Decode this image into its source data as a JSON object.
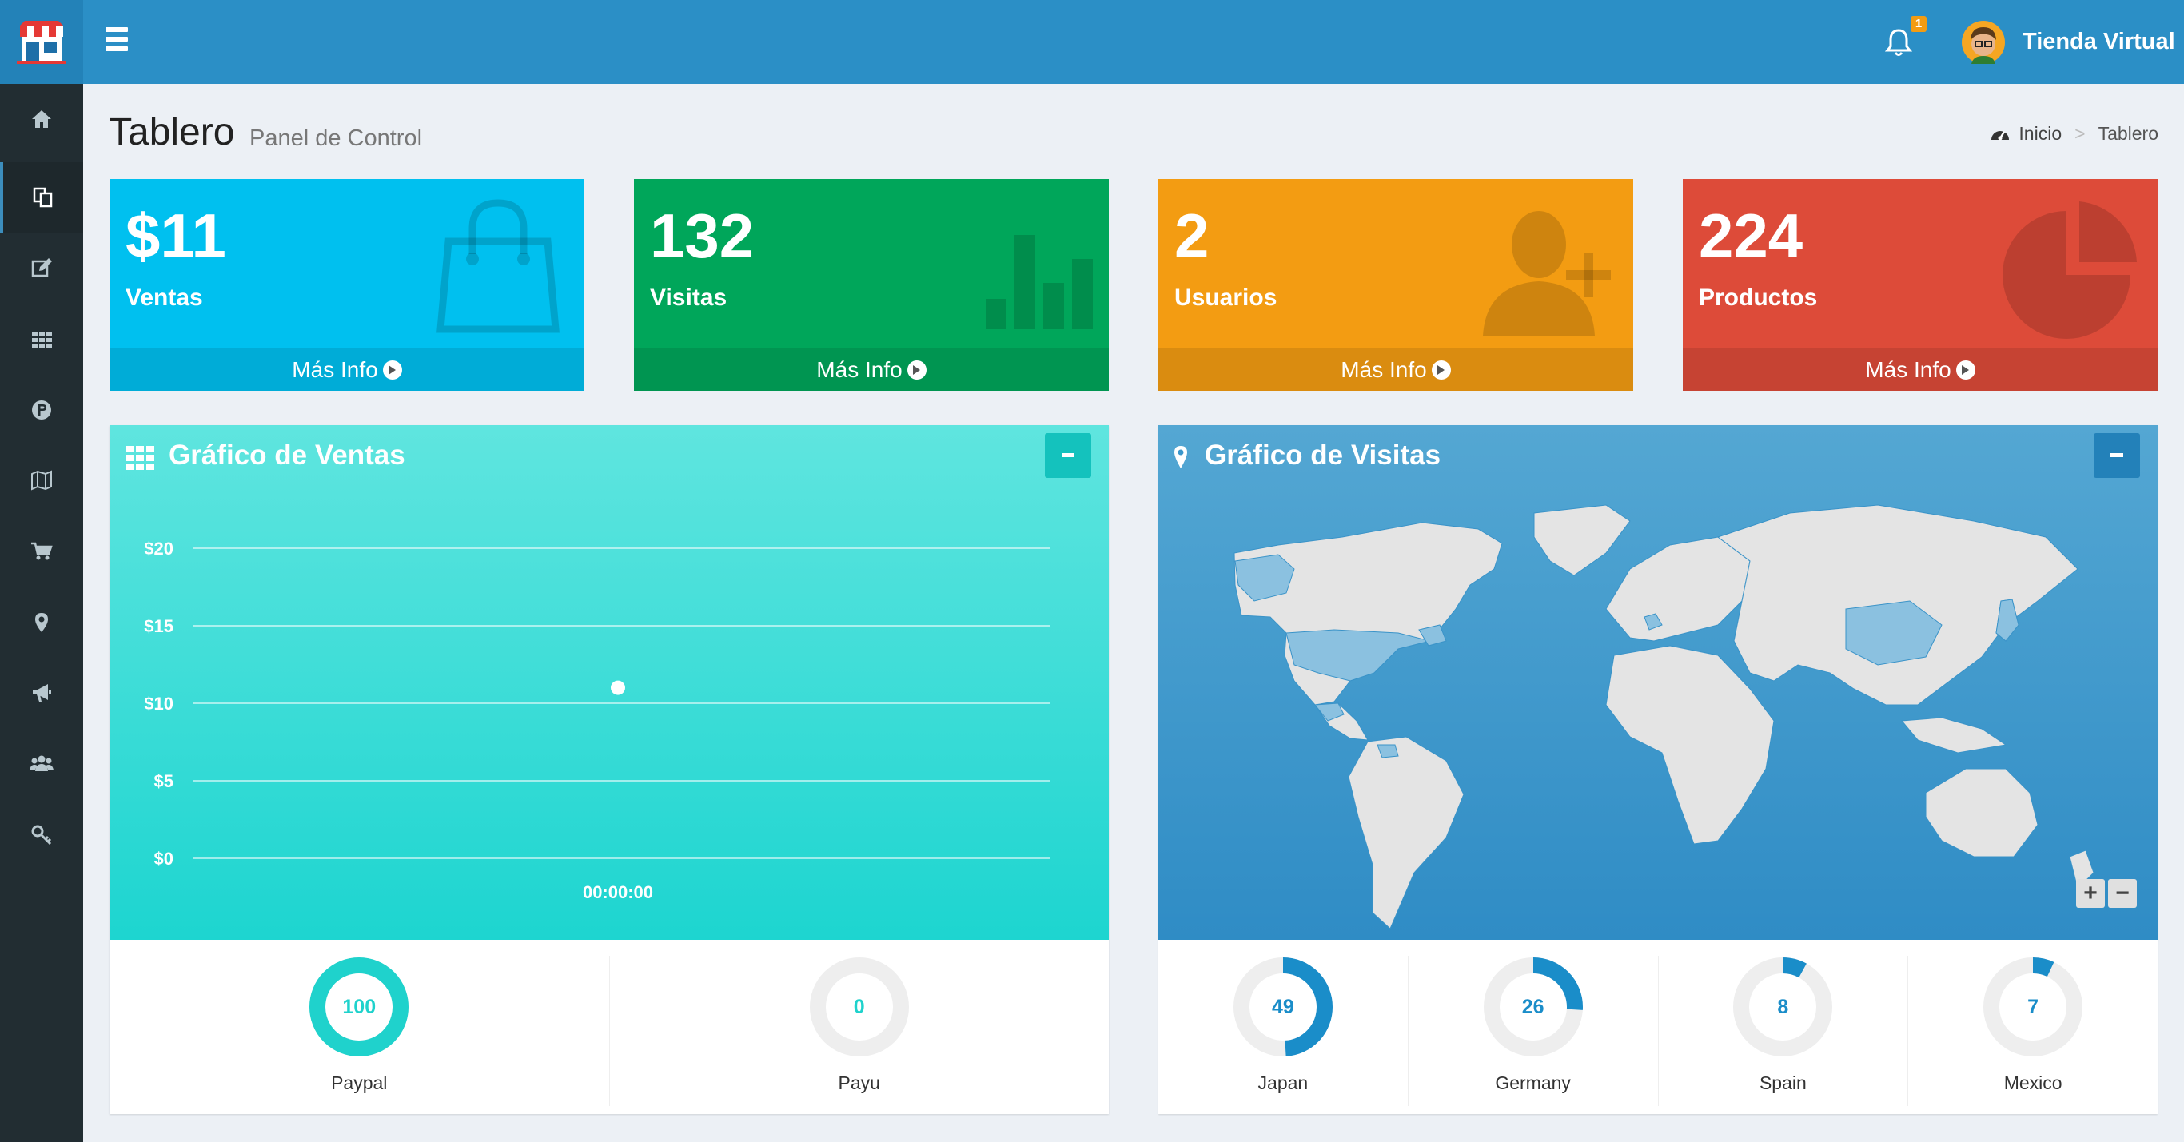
{
  "topbar": {
    "notification_count": "1",
    "user_name": "Tienda Virtual"
  },
  "sidebar": {
    "items": [
      {
        "icon": "home-icon"
      },
      {
        "icon": "dashboard-icon",
        "active": true
      },
      {
        "icon": "edit-icon"
      },
      {
        "icon": "grid-icon"
      },
      {
        "icon": "paypal-icon"
      },
      {
        "icon": "map-icon"
      },
      {
        "icon": "cart-icon"
      },
      {
        "icon": "map-marker-icon"
      },
      {
        "icon": "bullhorn-icon"
      },
      {
        "icon": "users-icon"
      },
      {
        "icon": "key-icon"
      }
    ]
  },
  "header": {
    "title": "Tablero",
    "subtitle": "Panel de Control",
    "breadcrumb": {
      "home": "Inicio",
      "current": "Tablero"
    }
  },
  "stat_boxes": [
    {
      "value": "$11",
      "label": "Ventas",
      "link": "Más Info",
      "color": "#00c0ef",
      "icon": "shopping-bag-icon"
    },
    {
      "value": "132",
      "label": "Visitas",
      "link": "Más Info",
      "color": "#00a65a",
      "icon": "bar-chart-icon"
    },
    {
      "value": "2",
      "label": "Usuarios",
      "link": "Más Info",
      "color": "#f39c12",
      "icon": "user-plus-icon"
    },
    {
      "value": "224",
      "label": "Productos",
      "link": "Más Info",
      "color": "#dd4b39",
      "icon": "pie-chart-icon"
    }
  ],
  "sales_panel": {
    "title": "Gráfico de Ventas",
    "payment_methods": [
      {
        "label": "Paypal",
        "value": "100",
        "percent": 100,
        "color": "#1fd2cc"
      },
      {
        "label": "Payu",
        "value": "0",
        "percent": 0,
        "color": "#1fd2cc"
      }
    ]
  },
  "visits_panel": {
    "title": "Gráfico de Visitas",
    "zoom_in": "+",
    "zoom_out": "−",
    "countries": [
      {
        "label": "Japan",
        "value": "49",
        "percent": 49,
        "color": "#1a8dc9"
      },
      {
        "label": "Germany",
        "value": "26",
        "percent": 26,
        "color": "#1a8dc9"
      },
      {
        "label": "Spain",
        "value": "8",
        "percent": 8,
        "color": "#1a8dc9"
      },
      {
        "label": "Mexico",
        "value": "7",
        "percent": 7,
        "color": "#1a8dc9"
      }
    ]
  },
  "chart_data": {
    "type": "line",
    "title": "",
    "x": [
      "00:00:00"
    ],
    "series": [
      {
        "values": [
          11
        ]
      }
    ],
    "ylim": [
      0,
      20
    ],
    "yticks": [
      "$0",
      "$5",
      "$10",
      "$15",
      "$20"
    ],
    "grid": true
  }
}
